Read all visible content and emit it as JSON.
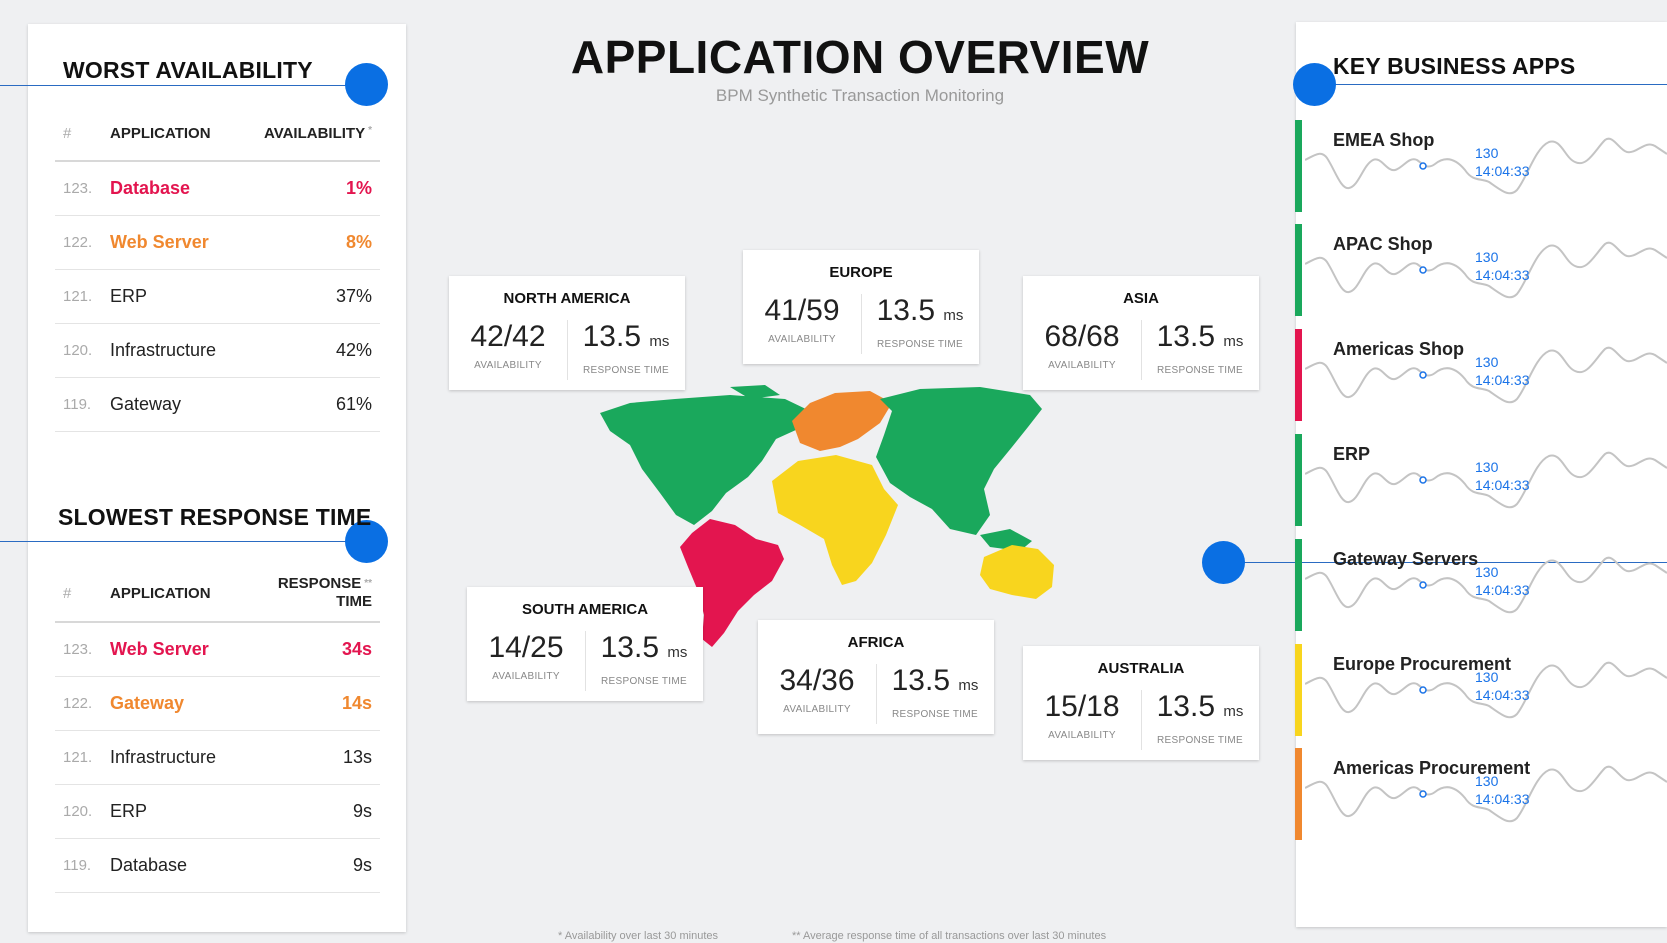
{
  "header": {
    "title": "APPLICATION OVERVIEW",
    "subtitle": "BPM Synthetic Transaction Monitoring"
  },
  "worst_availability": {
    "title": "WORST AVAILABILITY",
    "columns": {
      "num": "#",
      "app": "APPLICATION",
      "value": "AVAILABILITY",
      "note": "*"
    },
    "rows": [
      {
        "num": "123.",
        "app": "Database",
        "value": "1%",
        "color": "#e3154f"
      },
      {
        "num": "122.",
        "app": "Web Server",
        "value": "8%",
        "color": "#f0882f"
      },
      {
        "num": "121.",
        "app": "ERP",
        "value": "37%",
        "color": "#222222"
      },
      {
        "num": "120.",
        "app": "Infrastructure",
        "value": "42%",
        "color": "#222222"
      },
      {
        "num": "119.",
        "app": "Gateway",
        "value": "61%",
        "color": "#222222"
      }
    ]
  },
  "slowest_response": {
    "title": "SLOWEST RESPONSE TIME",
    "columns": {
      "num": "#",
      "app": "APPLICATION",
      "value_line1": "RESPONSE",
      "value_line2": "TIME",
      "note": "**"
    },
    "rows": [
      {
        "num": "123.",
        "app": "Web Server",
        "value": "34s",
        "color": "#e3154f"
      },
      {
        "num": "122.",
        "app": "Gateway",
        "value": "14s",
        "color": "#f0882f"
      },
      {
        "num": "121.",
        "app": "Infrastructure",
        "value": "13s",
        "color": "#222222"
      },
      {
        "num": "120.",
        "app": "ERP",
        "value": "9s",
        "color": "#222222"
      },
      {
        "num": "119.",
        "app": "Database",
        "value": "9s",
        "color": "#222222"
      }
    ]
  },
  "regions": {
    "availability_label": "AVAILABILITY",
    "response_label": "RESPONSE TIME",
    "unit": "ms",
    "north_america": {
      "name": "NORTH AMERICA",
      "availability": "42/42",
      "response": "13.5"
    },
    "europe": {
      "name": "EUROPE",
      "availability": "41/59",
      "response": "13.5"
    },
    "asia": {
      "name": "ASIA",
      "availability": "68/68",
      "response": "13.5"
    },
    "south_america": {
      "name": "SOUTH AMERICA",
      "availability": "14/25",
      "response": "13.5"
    },
    "africa": {
      "name": "AFRICA",
      "availability": "34/36",
      "response": "13.5"
    },
    "australia": {
      "name": "AUSTRALIA",
      "availability": "15/18",
      "response": "13.5"
    }
  },
  "map_colors": {
    "north_america": "#1aa85c",
    "europe": "#f0882f",
    "asia": "#1aa85c",
    "south_america": "#e3154f",
    "africa": "#f8d51e",
    "australia": "#f8d51e"
  },
  "footnotes": {
    "availability": "*  Availability over last 30 minutes",
    "response": "**  Average response time of all transactions over last 30 minutes"
  },
  "key_apps": {
    "title": "KEY BUSINESS APPS",
    "items": [
      {
        "name": "EMEA Shop",
        "value": "130",
        "time": "14:04:33",
        "status_color": "#1aa85c"
      },
      {
        "name": "APAC Shop",
        "value": "130",
        "time": "14:04:33",
        "status_color": "#1aa85c"
      },
      {
        "name": "Americas Shop",
        "value": "130",
        "time": "14:04:33",
        "status_color": "#e3154f"
      },
      {
        "name": "ERP",
        "value": "130",
        "time": "14:04:33",
        "status_color": "#1aa85c"
      },
      {
        "name": "Gateway Servers",
        "value": "130",
        "time": "14:04:33",
        "status_color": "#1aa85c"
      },
      {
        "name": "Europe Procurement",
        "value": "130",
        "time": "14:04:33",
        "status_color": "#f8d51e"
      },
      {
        "name": "Americas Procurement",
        "value": "130",
        "time": "14:04:33",
        "status_color": "#f0882f"
      }
    ]
  },
  "colors": {
    "accent": "#0a6fe3",
    "critical": "#e3154f",
    "warning": "#f0882f",
    "ok": "#1aa85c",
    "degraded": "#f8d51e"
  }
}
